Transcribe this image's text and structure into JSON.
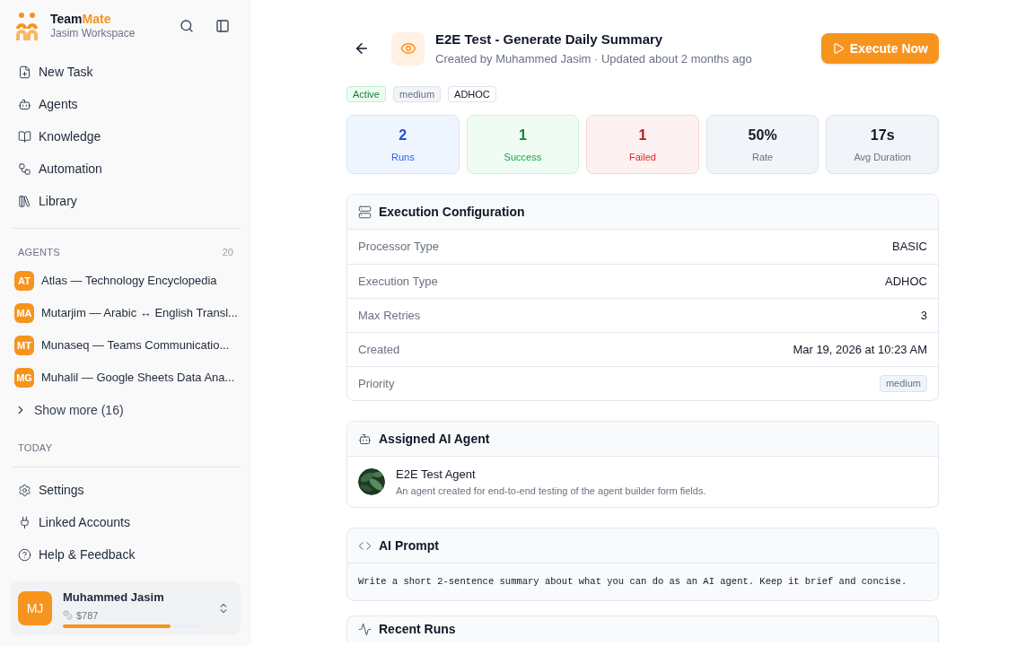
{
  "sidebar": {
    "brand": {
      "first": "Team",
      "second": "Mate",
      "workspace": "Jasim Workspace"
    },
    "nav": [
      {
        "label": "New Task"
      },
      {
        "label": "Agents"
      },
      {
        "label": "Knowledge"
      },
      {
        "label": "Automation"
      },
      {
        "label": "Library"
      }
    ],
    "agents_heading": "AGENTS",
    "agents_count": "20",
    "agents": [
      {
        "initials": "AT",
        "name": "Atlas — Technology Encyclopedia"
      },
      {
        "initials": "MA",
        "name": "Mutarjim — Arabic ↔ English Transl..."
      },
      {
        "initials": "MT",
        "name": "Munaseq — Teams Communicatio..."
      },
      {
        "initials": "MG",
        "name": "Muhalil — Google Sheets Data Ana..."
      }
    ],
    "show_more": "Show more (16)",
    "today_heading": "TODAY",
    "bottom_nav": [
      {
        "label": "Settings"
      },
      {
        "label": "Linked Accounts"
      },
      {
        "label": "Help & Feedback"
      }
    ],
    "user": {
      "initials": "MJ",
      "name": "Muhammed Jasim",
      "credits": "$787",
      "level": 0.79
    }
  },
  "header": {
    "title": "E2E Test - Generate Daily Summary",
    "subtitle": "Created by Muhammed Jasim · Updated about 2 months ago",
    "execute": "Execute Now"
  },
  "tags": [
    {
      "label": "Active",
      "kind": "status"
    },
    {
      "label": "medium",
      "kind": "priority"
    },
    {
      "label": "ADHOC",
      "kind": "type"
    }
  ],
  "stats": [
    {
      "value": "2",
      "label": "Runs",
      "kind": "blue"
    },
    {
      "value": "1",
      "label": "Success",
      "kind": "green"
    },
    {
      "value": "1",
      "label": "Failed",
      "kind": "red"
    },
    {
      "value": "50%",
      "label": "Rate",
      "kind": "neutral"
    },
    {
      "value": "17s",
      "label": "Avg Duration",
      "kind": "neutral"
    }
  ],
  "config": {
    "title": "Execution Configuration",
    "rows": [
      {
        "label": "Processor Type",
        "value": "BASIC",
        "kind": "text"
      },
      {
        "label": "Execution Type",
        "value": "ADHOC",
        "kind": "text"
      },
      {
        "label": "Max Retries",
        "value": "3",
        "kind": "text"
      },
      {
        "label": "Created",
        "value": "Mar 19, 2026 at 10:23 AM",
        "kind": "text"
      },
      {
        "label": "Priority",
        "value": "medium",
        "kind": "badge"
      }
    ]
  },
  "agent": {
    "title": "Assigned AI Agent",
    "name": "E2E Test Agent",
    "description": "An agent created for end-to-end testing of the agent builder form fields."
  },
  "prompt": {
    "title": "AI Prompt",
    "text": "Write a short 2-sentence summary about what you can do as an AI agent. Keep it brief and concise."
  },
  "recent_runs": {
    "title": "Recent Runs"
  }
}
